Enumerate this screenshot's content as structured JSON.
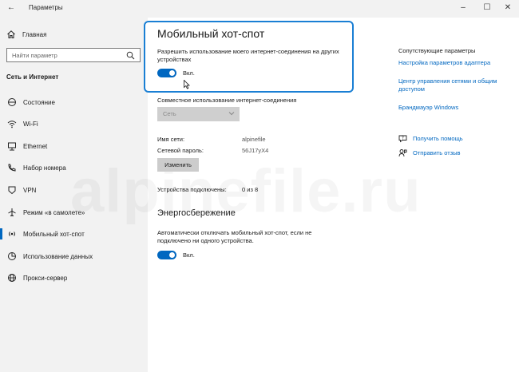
{
  "window": {
    "title": "Параметры",
    "controls": [
      "minimize",
      "maximize",
      "close"
    ]
  },
  "sidebar": {
    "home_label": "Главная",
    "search_placeholder": "Найти параметр",
    "section_title": "Сеть и Интернет",
    "items": [
      {
        "label": "Состояние",
        "icon": "status-icon"
      },
      {
        "label": "Wi-Fi",
        "icon": "wifi-icon"
      },
      {
        "label": "Ethernet",
        "icon": "ethernet-icon"
      },
      {
        "label": "Набор номера",
        "icon": "dialup-icon"
      },
      {
        "label": "VPN",
        "icon": "vpn-icon"
      },
      {
        "label": "Режим «в самолете»",
        "icon": "airplane-icon"
      },
      {
        "label": "Мобильный хот-спот",
        "icon": "hotspot-icon",
        "selected": true
      },
      {
        "label": "Использование данных",
        "icon": "data-usage-icon"
      },
      {
        "label": "Прокси-сервер",
        "icon": "proxy-icon"
      }
    ]
  },
  "main": {
    "title": "Мобильный хот-спот",
    "share_desc": "Разрешить использование моего интернет-соединения на других устройствах",
    "share_toggle": {
      "state": "on",
      "label": "Вкл."
    },
    "share_from_label": "Совместное использование интернет-соединения",
    "share_from_value": "Сеть",
    "network_name_label": "Имя сети:",
    "network_name_value": "alpinefile",
    "password_label": "Сетевой пароль:",
    "password_value": "56J17yX4",
    "edit_button": "Изменить",
    "devices_label": "Устройства подключены:",
    "devices_value": "0 из 8",
    "power_title": "Энергосбережение",
    "power_desc": "Автоматически отключать мобильный хот-спот, если не подключено ни одного устройства.",
    "power_toggle": {
      "state": "on",
      "label": "Вкл."
    }
  },
  "related": {
    "title": "Сопутствующие параметры",
    "links": [
      "Настройка параметров адаптера",
      "Центр управления сетями и общим доступом",
      "Брандмауэр Windows"
    ],
    "help": "Получить помощь",
    "feedback": "Отправить отзыв"
  },
  "watermark": "alpinefile.ru",
  "colors": {
    "accent": "#0067c0",
    "highlight_border": "#1a7fd4",
    "sidebar_bg": "#f2f2f2"
  }
}
